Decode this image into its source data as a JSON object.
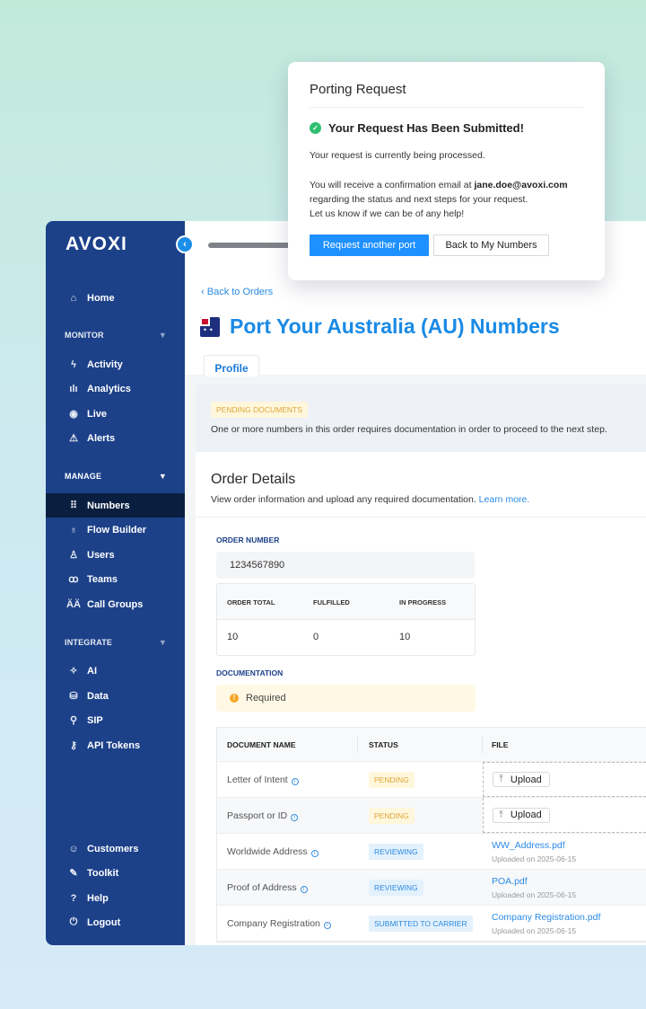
{
  "brand": "AVOXI",
  "colors": {
    "sidebar": "#1c4189",
    "active": "#0a1f3f",
    "accent": "#1e90ff",
    "title": "#1a8ae5"
  },
  "sidebar": {
    "home": "Home",
    "monitor": {
      "label": "MONITOR",
      "items": [
        "Activity",
        "Analytics",
        "Live",
        "Alerts"
      ]
    },
    "manage": {
      "label": "MANAGE",
      "items": [
        "Numbers",
        "Flow Builder",
        "Users",
        "Teams",
        "Call Groups"
      ]
    },
    "integrate": {
      "label": "INTEGRATE",
      "items": [
        "AI",
        "Data",
        "SIP",
        "API Tokens"
      ]
    },
    "bottom": [
      "Customers",
      "Toolkit",
      "Help",
      "Logout"
    ],
    "active": "Numbers"
  },
  "modal": {
    "title": "Porting Request",
    "heading": "Your Request Has Been Submitted!",
    "line1": "Your request is currently being processed.",
    "line2a": "You will receive a confirmation email at ",
    "email": "jane.doe@avoxi.com",
    "line3": "regarding the status and next steps for your request.",
    "line4": "Let us know if we can be of any help!",
    "primary": "Request another port",
    "secondary": "Back to My Numbers"
  },
  "page": {
    "back": "Back to Orders",
    "title": "Port Your Australia (AU) Numbers",
    "tab": "Profile",
    "pending_badge": "PENDING DOCUMENTS",
    "pending_text": "One or more numbers in this order requires documentation in order to proceed to the next step.",
    "order_title": "Order Details",
    "order_sub": "View order information and upload any required documentation.",
    "learn_more": "Learn more.",
    "order_number_label": "ORDER NUMBER",
    "order_number": "1234567890",
    "stats": {
      "h": [
        "ORDER TOTAL",
        "FULFILLED",
        "IN PROGRESS"
      ],
      "v": [
        "10",
        "0",
        "10"
      ]
    },
    "doc_label": "DOCUMENTATION",
    "required": "Required"
  },
  "table": {
    "headers": [
      "DOCUMENT NAME",
      "STATUS",
      "FILE"
    ],
    "upload": "Upload",
    "rows": [
      {
        "name": "Letter of Intent",
        "status": "PENDING"
      },
      {
        "name": "Passport or ID",
        "status": "PENDING"
      },
      {
        "name": "Worldwide Address",
        "status": "REVIEWING",
        "file": "WW_Address.pdf",
        "date": "Uploaded on 2025-06-15"
      },
      {
        "name": "Proof of Address",
        "status": "REVIEWING",
        "file": "POA.pdf",
        "date": "Uploaded on 2025-06-15"
      },
      {
        "name": "Company Registration",
        "status": "SUBMITTED TO CARRIER",
        "file": "Company Registration.pdf",
        "date": "Uploaded on 2025-06-15"
      }
    ]
  }
}
